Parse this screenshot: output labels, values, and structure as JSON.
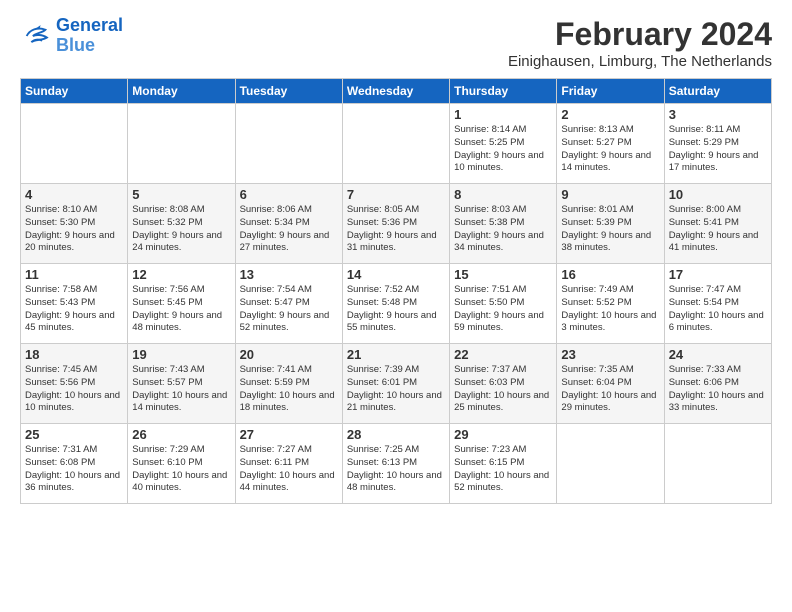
{
  "header": {
    "logo_line1": "General",
    "logo_line2": "Blue",
    "month_year": "February 2024",
    "location": "Einighausen, Limburg, The Netherlands"
  },
  "days_of_week": [
    "Sunday",
    "Monday",
    "Tuesday",
    "Wednesday",
    "Thursday",
    "Friday",
    "Saturday"
  ],
  "weeks": [
    [
      {
        "day": "",
        "info": ""
      },
      {
        "day": "",
        "info": ""
      },
      {
        "day": "",
        "info": ""
      },
      {
        "day": "",
        "info": ""
      },
      {
        "day": "1",
        "info": "Sunrise: 8:14 AM\nSunset: 5:25 PM\nDaylight: 9 hours and 10 minutes."
      },
      {
        "day": "2",
        "info": "Sunrise: 8:13 AM\nSunset: 5:27 PM\nDaylight: 9 hours and 14 minutes."
      },
      {
        "day": "3",
        "info": "Sunrise: 8:11 AM\nSunset: 5:29 PM\nDaylight: 9 hours and 17 minutes."
      }
    ],
    [
      {
        "day": "4",
        "info": "Sunrise: 8:10 AM\nSunset: 5:30 PM\nDaylight: 9 hours and 20 minutes."
      },
      {
        "day": "5",
        "info": "Sunrise: 8:08 AM\nSunset: 5:32 PM\nDaylight: 9 hours and 24 minutes."
      },
      {
        "day": "6",
        "info": "Sunrise: 8:06 AM\nSunset: 5:34 PM\nDaylight: 9 hours and 27 minutes."
      },
      {
        "day": "7",
        "info": "Sunrise: 8:05 AM\nSunset: 5:36 PM\nDaylight: 9 hours and 31 minutes."
      },
      {
        "day": "8",
        "info": "Sunrise: 8:03 AM\nSunset: 5:38 PM\nDaylight: 9 hours and 34 minutes."
      },
      {
        "day": "9",
        "info": "Sunrise: 8:01 AM\nSunset: 5:39 PM\nDaylight: 9 hours and 38 minutes."
      },
      {
        "day": "10",
        "info": "Sunrise: 8:00 AM\nSunset: 5:41 PM\nDaylight: 9 hours and 41 minutes."
      }
    ],
    [
      {
        "day": "11",
        "info": "Sunrise: 7:58 AM\nSunset: 5:43 PM\nDaylight: 9 hours and 45 minutes."
      },
      {
        "day": "12",
        "info": "Sunrise: 7:56 AM\nSunset: 5:45 PM\nDaylight: 9 hours and 48 minutes."
      },
      {
        "day": "13",
        "info": "Sunrise: 7:54 AM\nSunset: 5:47 PM\nDaylight: 9 hours and 52 minutes."
      },
      {
        "day": "14",
        "info": "Sunrise: 7:52 AM\nSunset: 5:48 PM\nDaylight: 9 hours and 55 minutes."
      },
      {
        "day": "15",
        "info": "Sunrise: 7:51 AM\nSunset: 5:50 PM\nDaylight: 9 hours and 59 minutes."
      },
      {
        "day": "16",
        "info": "Sunrise: 7:49 AM\nSunset: 5:52 PM\nDaylight: 10 hours and 3 minutes."
      },
      {
        "day": "17",
        "info": "Sunrise: 7:47 AM\nSunset: 5:54 PM\nDaylight: 10 hours and 6 minutes."
      }
    ],
    [
      {
        "day": "18",
        "info": "Sunrise: 7:45 AM\nSunset: 5:56 PM\nDaylight: 10 hours and 10 minutes."
      },
      {
        "day": "19",
        "info": "Sunrise: 7:43 AM\nSunset: 5:57 PM\nDaylight: 10 hours and 14 minutes."
      },
      {
        "day": "20",
        "info": "Sunrise: 7:41 AM\nSunset: 5:59 PM\nDaylight: 10 hours and 18 minutes."
      },
      {
        "day": "21",
        "info": "Sunrise: 7:39 AM\nSunset: 6:01 PM\nDaylight: 10 hours and 21 minutes."
      },
      {
        "day": "22",
        "info": "Sunrise: 7:37 AM\nSunset: 6:03 PM\nDaylight: 10 hours and 25 minutes."
      },
      {
        "day": "23",
        "info": "Sunrise: 7:35 AM\nSunset: 6:04 PM\nDaylight: 10 hours and 29 minutes."
      },
      {
        "day": "24",
        "info": "Sunrise: 7:33 AM\nSunset: 6:06 PM\nDaylight: 10 hours and 33 minutes."
      }
    ],
    [
      {
        "day": "25",
        "info": "Sunrise: 7:31 AM\nSunset: 6:08 PM\nDaylight: 10 hours and 36 minutes."
      },
      {
        "day": "26",
        "info": "Sunrise: 7:29 AM\nSunset: 6:10 PM\nDaylight: 10 hours and 40 minutes."
      },
      {
        "day": "27",
        "info": "Sunrise: 7:27 AM\nSunset: 6:11 PM\nDaylight: 10 hours and 44 minutes."
      },
      {
        "day": "28",
        "info": "Sunrise: 7:25 AM\nSunset: 6:13 PM\nDaylight: 10 hours and 48 minutes."
      },
      {
        "day": "29",
        "info": "Sunrise: 7:23 AM\nSunset: 6:15 PM\nDaylight: 10 hours and 52 minutes."
      },
      {
        "day": "",
        "info": ""
      },
      {
        "day": "",
        "info": ""
      }
    ]
  ]
}
